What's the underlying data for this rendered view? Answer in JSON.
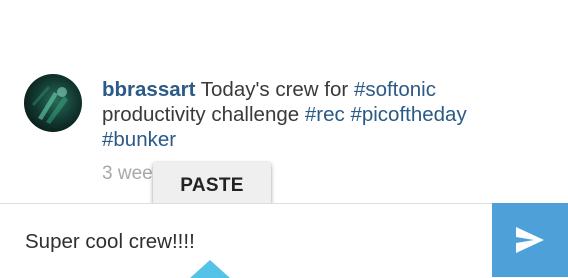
{
  "comment": {
    "username": "bbrassart",
    "text_before": " Today's crew for ",
    "hashtag_1": "#softonic",
    "text_middle": " productivity challenge ",
    "hashtag_2": "#rec",
    "space_1": " ",
    "hashtag_3": "#picoftheday",
    "space_2": " ",
    "hashtag_4": "#bunker",
    "timestamp": "3 wee"
  },
  "context_menu": {
    "paste_label": "PASTE"
  },
  "composer": {
    "input_value": "Super cool crew!!!!",
    "send_icon": "send-icon"
  },
  "colors": {
    "link": "#2b5a87",
    "send_button": "#4ea0d9",
    "selection_handle": "#55c2e8"
  }
}
